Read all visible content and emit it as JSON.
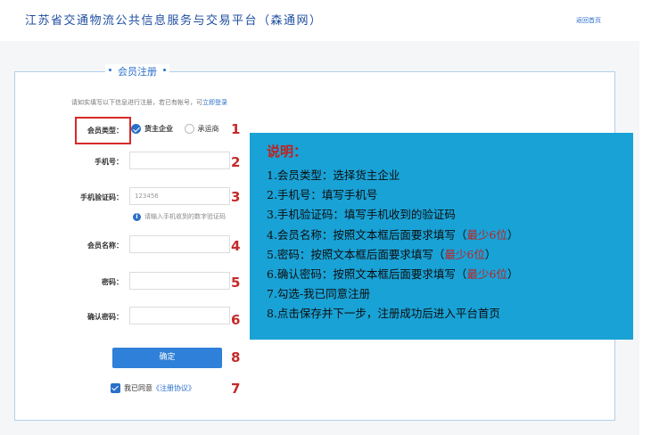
{
  "header": {
    "site_title": "江苏省交通物流公共信息服务与交易平台（森通网）",
    "home_link": "返回首页"
  },
  "form": {
    "legend": "会员注册",
    "notice_prefix": "请如实填写以下信息进行注册，若已有帐号，可",
    "notice_login": "立即登录",
    "member_type": {
      "label": "会员类型：",
      "options": [
        "货主企业",
        "承运商"
      ],
      "selected": "货主企业"
    },
    "phone": {
      "label": "手机号：",
      "value": ""
    },
    "sms_code": {
      "label": "手机验证码：",
      "value": "123456",
      "hint": "请输入手机收到的数字验证码"
    },
    "member_name": {
      "label": "会员名称：",
      "value": ""
    },
    "password": {
      "label": "密码：",
      "value": ""
    },
    "confirm_password": {
      "label": "确认密码：",
      "value": ""
    },
    "confirm_button": "确定",
    "agree": {
      "checked": true,
      "prefix": "我已同意",
      "link": "《注册协议》"
    }
  },
  "step_numbers": [
    "1",
    "2",
    "3",
    "4",
    "5",
    "6",
    "8",
    "7"
  ],
  "explanation": {
    "heading": "说明：",
    "lines": [
      {
        "text": "1.会员类型：选择货主企业",
        "highlight": ""
      },
      {
        "text": "2.手机号：填写手机号",
        "highlight": ""
      },
      {
        "text": "3.手机验证码：填写手机收到的验证码",
        "highlight": ""
      },
      {
        "text": "4.会员名称：按照文本框后面要求填写（",
        "highlight": "最少6位",
        "tail": "）"
      },
      {
        "text": "5.密码：按照文本框后面要求填写（",
        "highlight": "最少6位",
        "tail": "）"
      },
      {
        "text": "6.确认密码：按照文本框后面要求填写（",
        "highlight": "最少6位",
        "tail": "）"
      },
      {
        "text": "7.勾选-我已同意注册",
        "highlight": ""
      },
      {
        "text": "8.点击保存并下一步，注册成功后进入平台首页",
        "highlight": ""
      }
    ]
  },
  "colors": {
    "accent": "#2a6fc9",
    "button": "#2f80d8",
    "step_red": "#c62a2a",
    "explain_bg": "#19a2d6"
  }
}
